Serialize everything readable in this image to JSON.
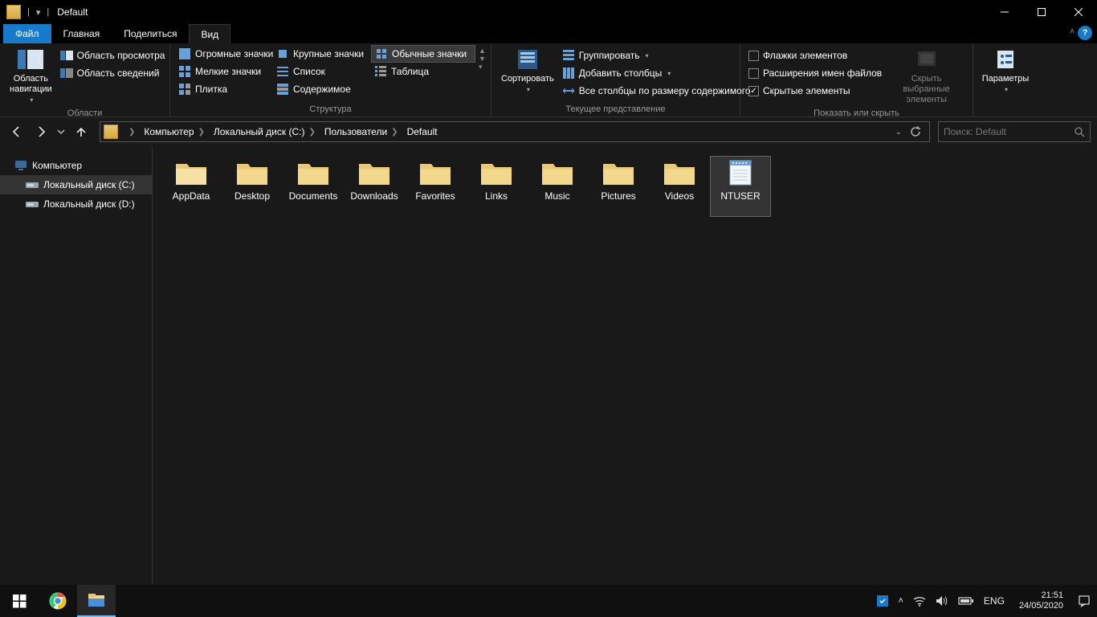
{
  "window": {
    "title": "Default"
  },
  "tabs": {
    "file": "Файл",
    "home": "Главная",
    "share": "Поделиться",
    "view": "Вид"
  },
  "ribbon": {
    "panes": {
      "nav_pane": "Область\nнавигации",
      "preview": "Область просмотра",
      "details_pane": "Область сведений",
      "group_label": "Области"
    },
    "layout": {
      "xl": "Огромные значки",
      "lg": "Крупные значки",
      "md": "Обычные значки",
      "sm": "Мелкие значки",
      "list": "Список",
      "details": "Таблица",
      "tiles": "Плитка",
      "content": "Содержимое",
      "group_label": "Структура"
    },
    "currentview": {
      "sort": "Сортировать",
      "group": "Группировать",
      "addcols": "Добавить столбцы",
      "sizecols": "Все столбцы по размеру содержимого",
      "group_label": "Текущее представление"
    },
    "showhide": {
      "chk_boxes": "Флажки элементов",
      "chk_ext": "Расширения имен файлов",
      "chk_hidden": "Скрытые элементы",
      "hidebtn": "Скрыть выбранные\nэлементы",
      "group_label": "Показать или скрыть"
    },
    "options": "Параметры"
  },
  "breadcrumb": [
    "Компьютер",
    "Локальный диск (C:)",
    "Пользователи",
    "Default"
  ],
  "search_placeholder": "Поиск: Default",
  "tree": {
    "computer": "Компьютер",
    "drive_c": "Локальный диск (C:)",
    "drive_d": "Локальный диск (D:)"
  },
  "items": [
    {
      "name": "AppData",
      "type": "folder-open"
    },
    {
      "name": "Desktop",
      "type": "folder"
    },
    {
      "name": "Documents",
      "type": "folder"
    },
    {
      "name": "Downloads",
      "type": "folder"
    },
    {
      "name": "Favorites",
      "type": "folder"
    },
    {
      "name": "Links",
      "type": "folder"
    },
    {
      "name": "Music",
      "type": "folder"
    },
    {
      "name": "Pictures",
      "type": "folder"
    },
    {
      "name": "Videos",
      "type": "folder"
    },
    {
      "name": "NTUSER",
      "type": "notepad",
      "selected": true
    }
  ],
  "tray": {
    "lang": "ENG",
    "time": "21:51",
    "date": "24/05/2020"
  }
}
